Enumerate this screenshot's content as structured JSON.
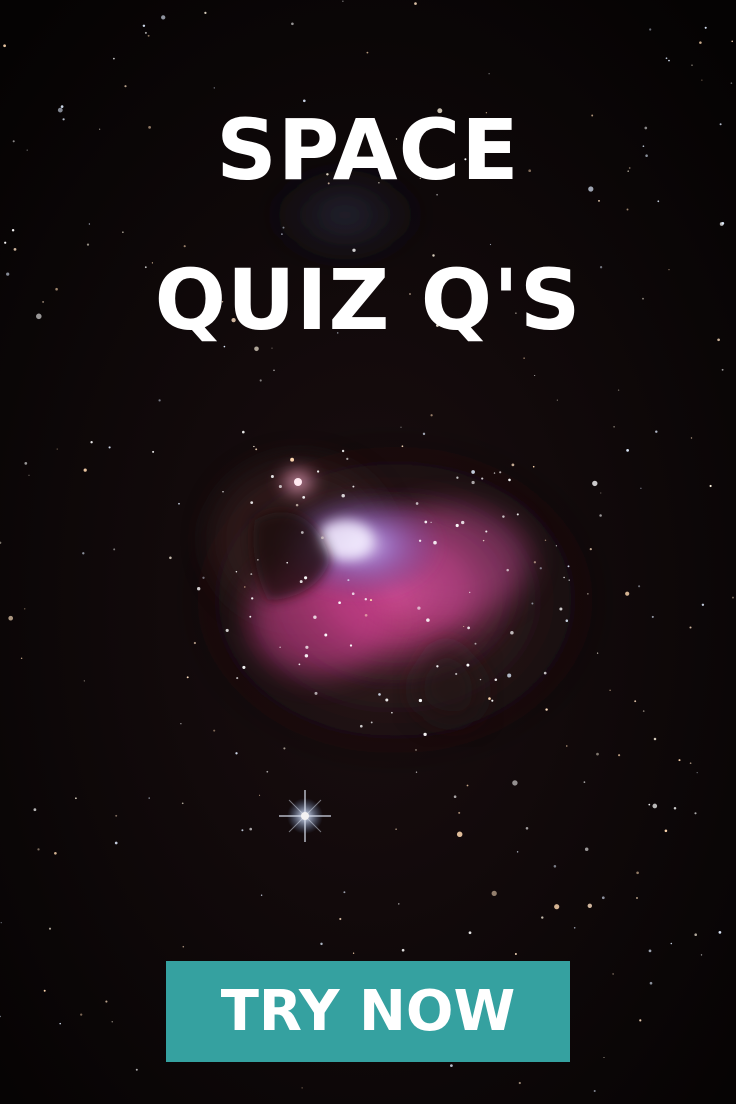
{
  "headline": {
    "line1": "SPACE",
    "line2": "QUIZ Q'S"
  },
  "cta": {
    "label": "TRY NOW",
    "color": "#35a1a0"
  },
  "background": {
    "subject": "nebula-star-field",
    "sky_color": "#080505",
    "nebula_colors": [
      "#d0408a",
      "#8a5fb8",
      "#6b3a4a"
    ]
  }
}
